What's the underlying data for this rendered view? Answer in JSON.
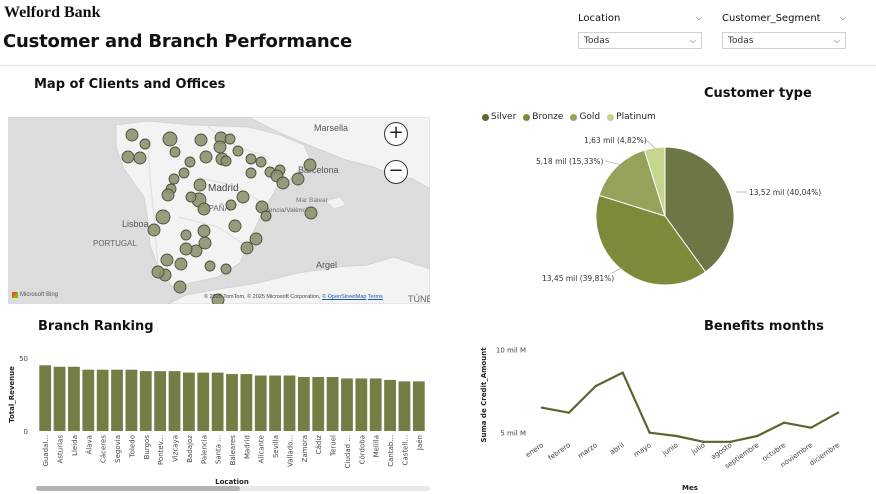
{
  "header": {
    "brand": "Welford Bank",
    "title": "Customer and Branch Performance"
  },
  "slicers": {
    "location": {
      "label": "Location",
      "value": "Todas"
    },
    "segment": {
      "label": "Customer_Segment",
      "value": "Todas"
    }
  },
  "map": {
    "title": "Map of Clients and Offices",
    "places": [
      "Marsella",
      "Barcelona",
      "Madrid",
      "ESPAÑA",
      "Lisboa",
      "PORTUGAL",
      "Mar Balear",
      "Valencia/València",
      "Argel",
      "TÚNEZ"
    ],
    "attribution": "© 2025 TomTom, © 2025 Microsoft Corporation, ",
    "attribution_link1": "© OpenStreetMap",
    "attribution_link2": "Terms",
    "bing_label": "Microsoft Bing",
    "zoom_in": "+",
    "zoom_out": "−",
    "bubble_color": "#8e9270"
  },
  "customer_type": {
    "title": "Customer type",
    "legend": [
      {
        "name": "Silver",
        "color": "#6b7845"
      },
      {
        "name": "Bronze",
        "color": "#7c8b3a"
      },
      {
        "name": "Gold",
        "color": "#94a25a"
      },
      {
        "name": "Platinum",
        "color": "#c4d58e"
      }
    ],
    "labels": {
      "silver": "13,52 mil (40,04%)",
      "bronze": "13,45 mil (39,81%)",
      "gold": "5,18 mil (15,33%)",
      "platinum": "1,63 mil (4,82%)"
    }
  },
  "branch_ranking": {
    "title": "Branch Ranking",
    "xlabel": "Location",
    "ylabel": "Total_Revenue"
  },
  "benefits": {
    "title": "Benefits months",
    "xlabel": "Mes",
    "ylabel": "Suma de Credit_Amount"
  },
  "chart_data": [
    {
      "type": "pie",
      "title": "Customer type",
      "categories": [
        "Silver",
        "Bronze",
        "Gold",
        "Platinum"
      ],
      "values": [
        13.52,
        13.45,
        5.18,
        1.63
      ],
      "percent": [
        40.04,
        39.81,
        15.33,
        4.82
      ],
      "colors": [
        "#6b7845",
        "#7c8b3a",
        "#94a25a",
        "#c4d58e"
      ],
      "legend": "top-left"
    },
    {
      "type": "bar",
      "title": "Branch Ranking",
      "xlabel": "Location",
      "ylabel": "Total_Revenue",
      "ylim": [
        0,
        50
      ],
      "yticks": [
        "0",
        "50"
      ],
      "color": "#737e44",
      "categories": [
        "Guadal...",
        "Asturias",
        "Lleida",
        "Álava",
        "Cáceres",
        "Segovia",
        "Toledo",
        "Burgos",
        "Pontev...",
        "Vizcaya",
        "Badajoz",
        "Palencia",
        "Santa ...",
        "Baleares",
        "Madrid",
        "Alicante",
        "Sevilla",
        "Vallado...",
        "Zamora",
        "Cádiz",
        "Teruel",
        "Ciudad ...",
        "Córdoba",
        "Melilla",
        "Cantab...",
        "Castell...",
        "Jaén"
      ],
      "values": [
        45,
        44,
        44,
        42,
        42,
        42,
        42,
        41,
        41,
        41,
        40,
        40,
        40,
        39,
        39,
        38,
        38,
        38,
        37,
        37,
        37,
        36,
        36,
        36,
        35,
        34,
        34
      ]
    },
    {
      "type": "line",
      "title": "Benefits months",
      "xlabel": "Mes",
      "ylabel": "Suma de Credit_Amount",
      "ylim": [
        4.8,
        10.2
      ],
      "yticks": [
        {
          "v": 5,
          "label": "5 mil M"
        },
        {
          "v": 10,
          "label": "10 mil M"
        }
      ],
      "color": "#5a6630",
      "categories": [
        "enero",
        "febrero",
        "marzo",
        "abril",
        "mayo",
        "junio",
        "julio",
        "agosto",
        "septiembre",
        "octubre",
        "noviembre",
        "diciembre"
      ],
      "values": [
        6.5,
        6.2,
        7.8,
        8.6,
        5.0,
        4.8,
        4.45,
        4.45,
        4.8,
        5.6,
        5.3,
        6.2
      ]
    }
  ]
}
